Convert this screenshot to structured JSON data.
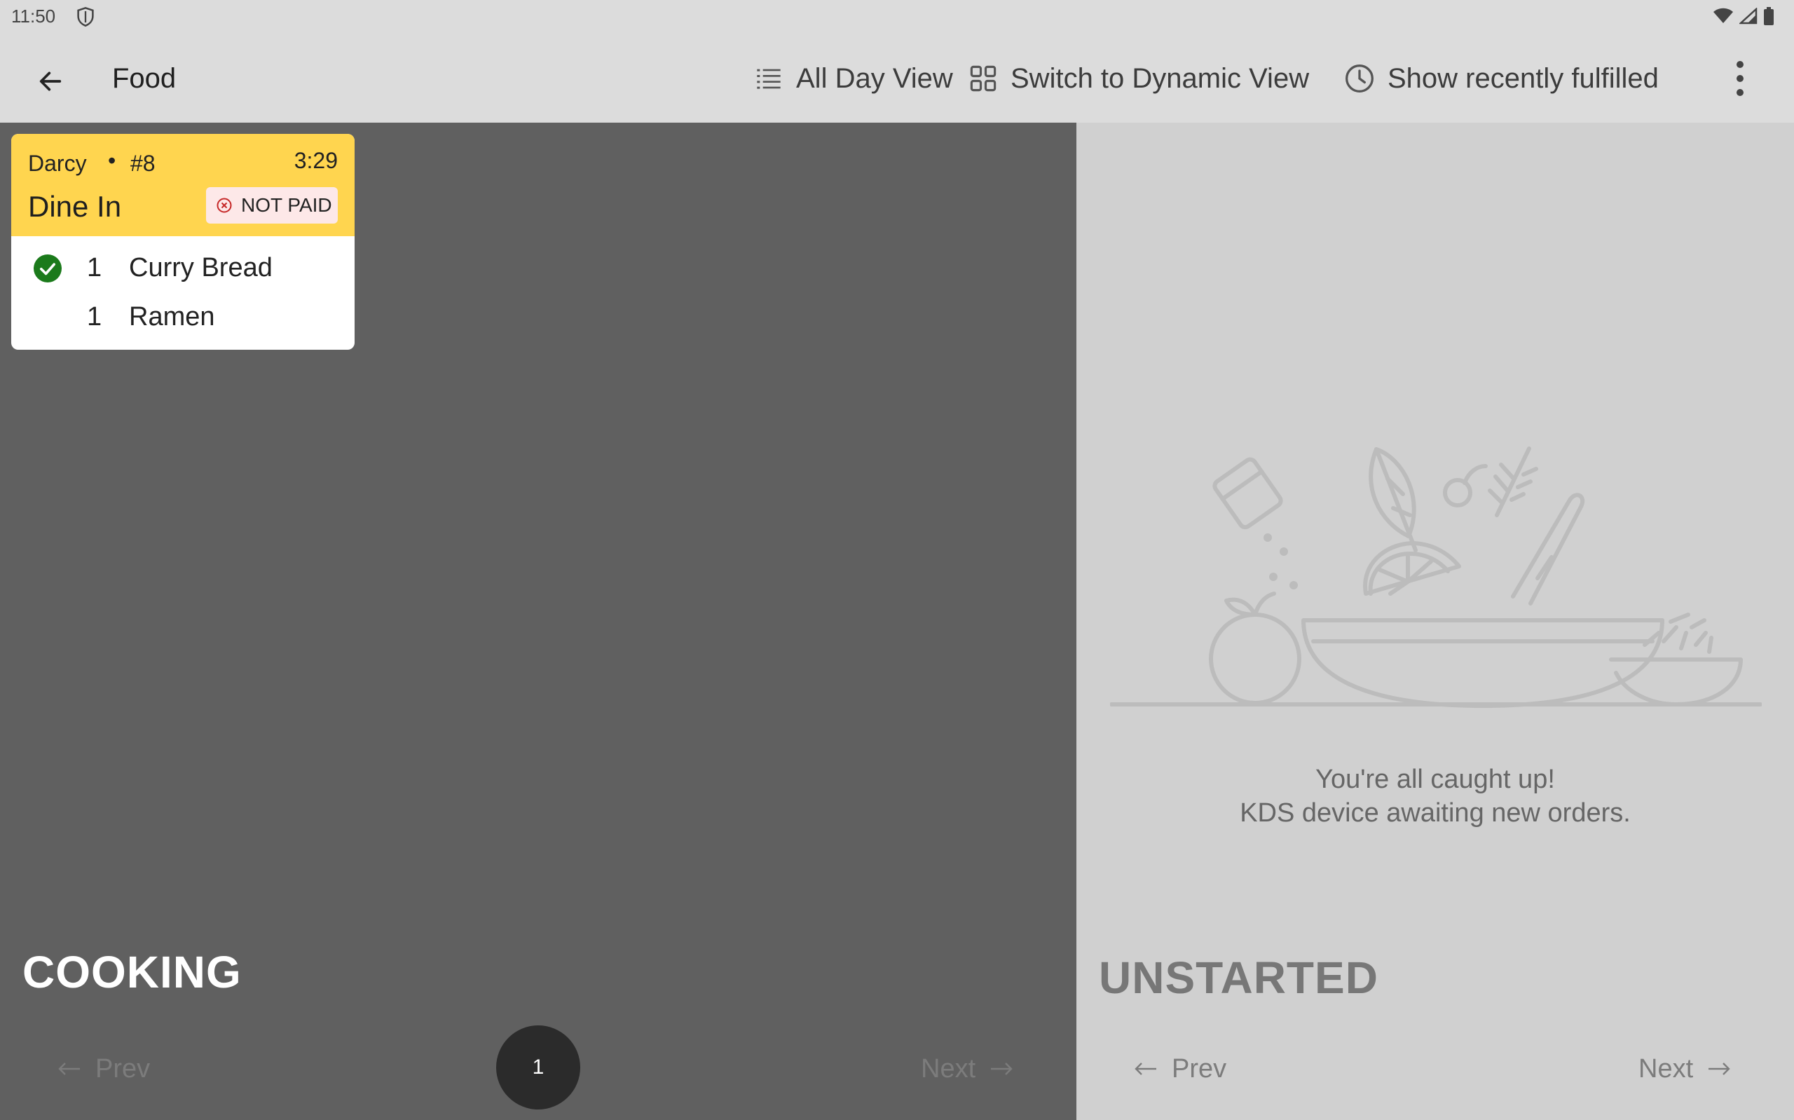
{
  "status_bar": {
    "time": "11:50",
    "icons": [
      "shield-icon",
      "wifi-icon",
      "signal-icon",
      "battery-icon"
    ]
  },
  "app_bar": {
    "title": "Food",
    "actions": {
      "all_day": "All Day View",
      "dynamic": "Switch to Dynamic View",
      "fulfilled": "Show recently fulfilled"
    }
  },
  "cooking": {
    "label": "COOKING",
    "ticket": {
      "customer": "Darcy",
      "separator": "•",
      "number": "#8",
      "time": "3:29",
      "type": "Dine In",
      "payment": "NOT PAID",
      "items": [
        {
          "qty": "1",
          "name": "Curry Bread",
          "done": true
        },
        {
          "qty": "1",
          "name": "Ramen",
          "done": false
        }
      ]
    },
    "pager": {
      "prev": "Prev",
      "next": "Next",
      "page": "1"
    }
  },
  "unstarted": {
    "label": "UNSTARTED",
    "empty_line1": "You're all caught up!",
    "empty_line2": "KDS device awaiting new orders.",
    "pager": {
      "prev": "Prev",
      "next": "Next"
    }
  },
  "colors": {
    "ticket_header": "#ffd54f",
    "cooking_bg": "#606060",
    "unstarted_bg": "#d0d0d0",
    "done_green": "#1b7a1b",
    "not_paid_red": "#c62828"
  }
}
